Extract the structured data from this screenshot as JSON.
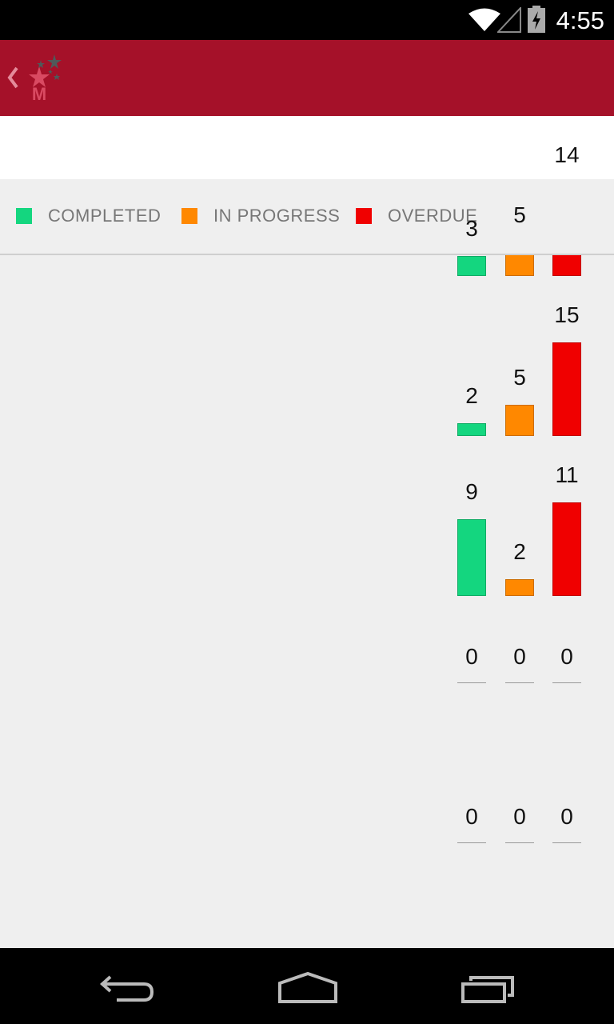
{
  "status_bar": {
    "time": "4:55",
    "icons": [
      "wifi-icon",
      "signal-icon",
      "battery-charging-icon"
    ]
  },
  "app_bar": {
    "back_icon": "chevron-left-icon",
    "logo": "stars-m-logo"
  },
  "legend": [
    {
      "label": "COMPLETED",
      "color": "#14d67f"
    },
    {
      "label": "IN PROGRESS",
      "color": "#ff8800"
    },
    {
      "label": "OVERDUE",
      "color": "#f00000"
    }
  ],
  "chart_data": {
    "type": "bar",
    "series_names": [
      "COMPLETED",
      "IN PROGRESS",
      "OVERDUE"
    ],
    "groups": [
      {
        "values": [
          3,
          5,
          14
        ]
      },
      {
        "values": [
          2,
          5,
          15
        ]
      },
      {
        "values": [
          9,
          2,
          11
        ]
      },
      {
        "values": [
          0,
          0,
          0
        ]
      },
      {
        "values": [
          0,
          0,
          0
        ]
      }
    ]
  },
  "nav_bar": {
    "icons": [
      "back-icon",
      "home-icon",
      "recents-icon"
    ]
  }
}
